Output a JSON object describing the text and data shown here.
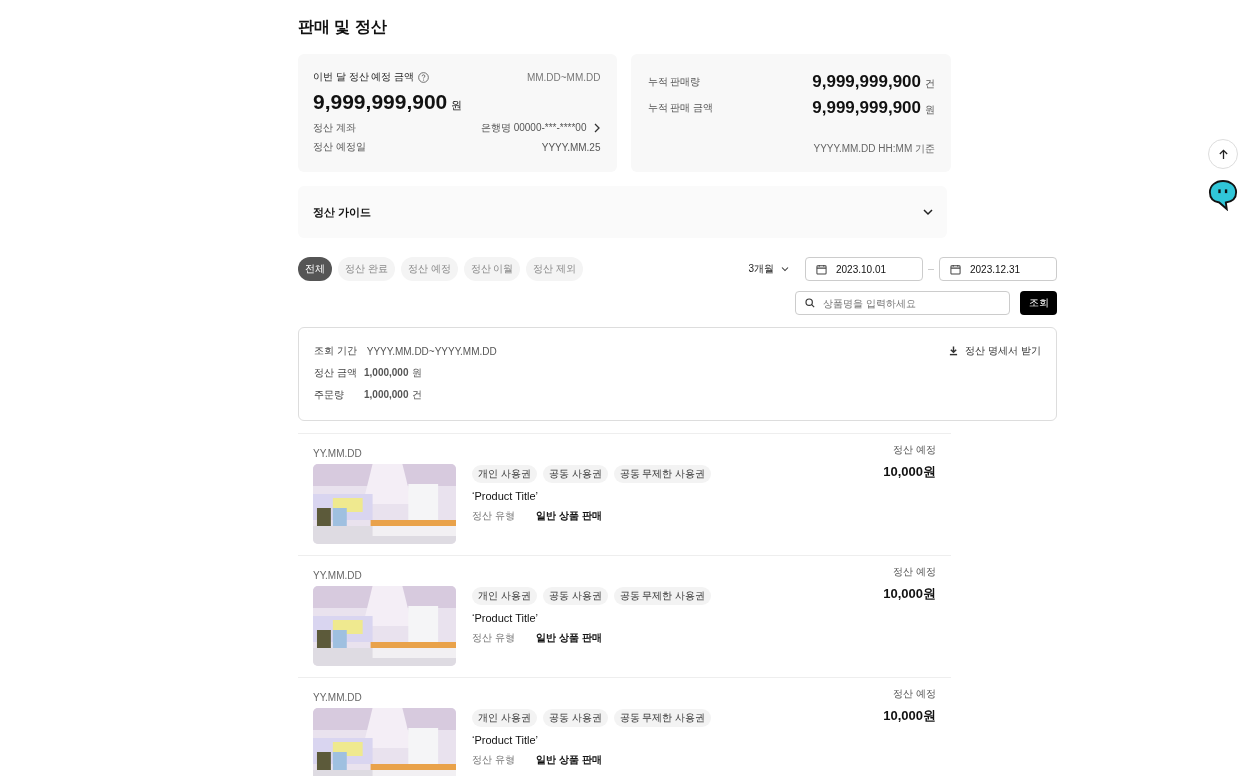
{
  "page_title": "판매 및 정산",
  "settlement_card": {
    "title": "이번 달 정산 예정 금액",
    "period": "MM.DD~MM.DD",
    "amount": "9,999,999,900",
    "unit": "원",
    "rows": [
      {
        "label": "정산 계좌",
        "value": "은행명 00000-***-****00",
        "kind": "link"
      },
      {
        "label": "정산 예정일",
        "value": "YYYY.MM.25",
        "kind": "plain"
      }
    ]
  },
  "sales_card": {
    "rows": [
      {
        "label": "누적 판매량",
        "value": "9,999,999,900",
        "unit": "건"
      },
      {
        "label": "누적 판매 금액",
        "value": "9,999,999,900",
        "unit": "원"
      }
    ],
    "basis": "YYYY.MM.DD HH:MM 기준"
  },
  "guide": {
    "title": "정산 가이드",
    "expanded": false
  },
  "filter_chips": [
    {
      "label": "전체",
      "selected": true
    },
    {
      "label": "정산 완료",
      "selected": false
    },
    {
      "label": "정산 예정",
      "selected": false
    },
    {
      "label": "정산 이월",
      "selected": false
    },
    {
      "label": "정산 제외",
      "selected": false
    }
  ],
  "period_select": "3개월",
  "start_date": "2023.10.01",
  "end_date": "2023.12.31",
  "search": {
    "placeholder": "상품명을 입력하세요",
    "button": "조회"
  },
  "summary": {
    "period_label": "조회 기간",
    "period": "YYYY.MM.DD~YYYY.MM.DD",
    "download": "정산 명세서 받기",
    "rows": [
      {
        "label": "정산 금액",
        "value": "1,000,000",
        "unit": "원"
      },
      {
        "label": "주문량",
        "value": "1,000,000",
        "unit": "건"
      }
    ]
  },
  "items": [
    {
      "date": "YY.MM.DD",
      "tags": [
        "개인 사용권",
        "공동 사용권",
        "공동 무제한 사용권"
      ],
      "title": "‘Product Title’",
      "type_label": "정산 유형",
      "type_value": "일반 상품 판매",
      "status": "정산 예정",
      "price": "10,000원"
    },
    {
      "date": "YY.MM.DD",
      "tags": [
        "개인 사용권",
        "공동 사용권",
        "공동 무제한 사용권"
      ],
      "title": "‘Product Title’",
      "type_label": "정산 유형",
      "type_value": "일반 상품 판매",
      "status": "정산 예정",
      "price": "10,000원"
    },
    {
      "date": "YY.MM.DD",
      "tags": [
        "개인 사용권",
        "공동 사용권",
        "공동 무제한 사용권"
      ],
      "title": "‘Product Title’",
      "type_label": "정산 유형",
      "type_value": "일반 상품 판매",
      "status": "정산 예정",
      "price": "10,000원"
    }
  ]
}
